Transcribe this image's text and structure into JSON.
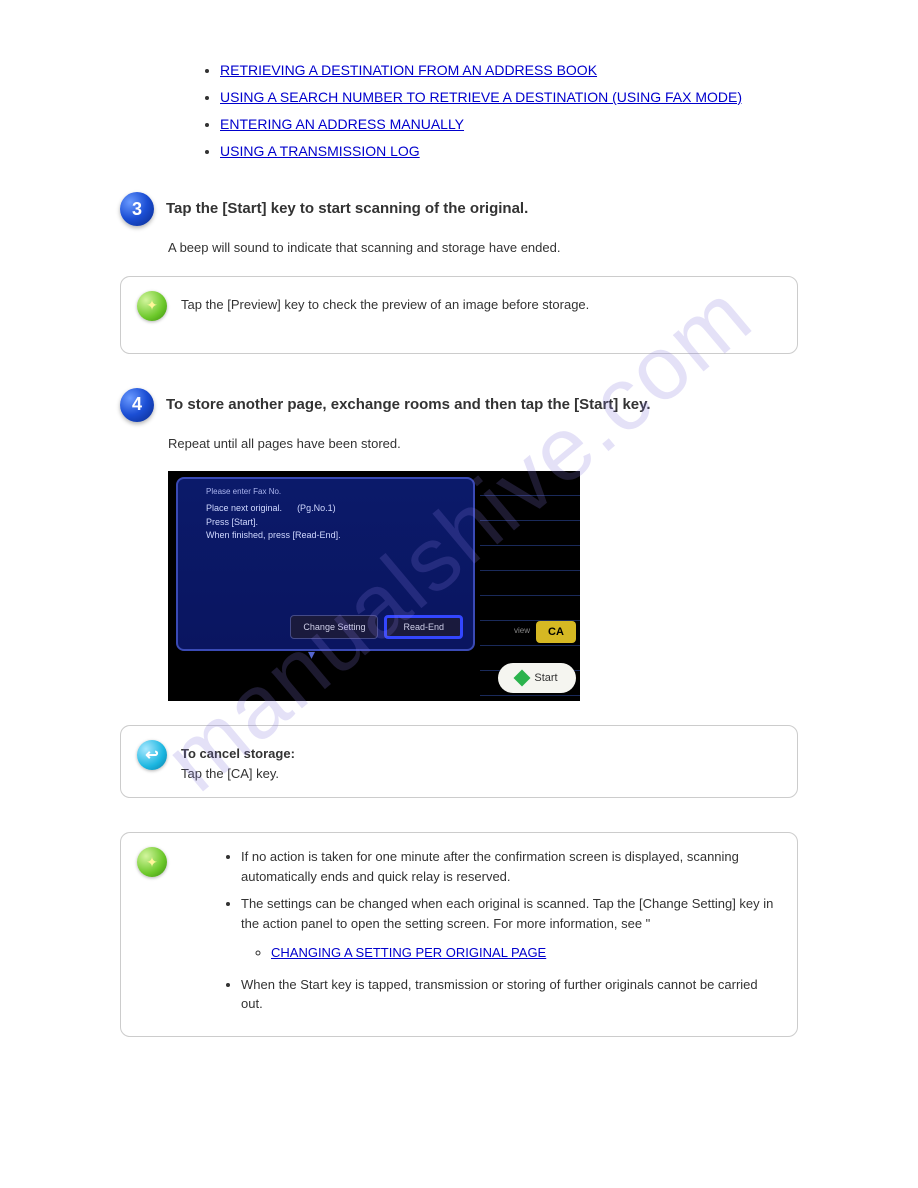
{
  "watermark": "manualshive.com",
  "top_links": [
    "RETRIEVING A DESTINATION FROM AN ADDRESS BOOK",
    "USING A SEARCH NUMBER TO RETRIEVE A DESTINATION (USING FAX MODE)",
    "ENTERING AN ADDRESS MANUALLY",
    "USING A TRANSMISSION LOG"
  ],
  "step3": {
    "label": "3",
    "text": "Tap the [Start] key to start scanning of the original.",
    "desc": "A beep will sound to indicate that scanning and storage have ended."
  },
  "note3": "Tap the [Preview] key to check the preview of an image before storage.",
  "step4": {
    "label": "4",
    "text": "To store another page, exchange rooms and then tap the [Start] key.",
    "desc": "Repeat until all pages have been stored."
  },
  "screen": {
    "header": "Please enter Fax No.",
    "line1_a": "Place next original.",
    "line1_b": "(Pg.No.1)",
    "line2": "Press [Start].",
    "line3": "When finished, press [Read-End].",
    "btn_change": "Change Setting",
    "btn_readend": "Read-End",
    "preview": "view",
    "ca": "CA",
    "start": "Start"
  },
  "cancel_note": {
    "title": "To cancel storage:",
    "text": "Tap the [CA] key."
  },
  "final_box": {
    "item1": "If no action is taken for one minute after the confirmation screen is displayed, scanning automatically ends and quick relay is reserved.",
    "item2_prefix": "The settings can be changed when each original is scanned. Tap the [Change Setting] key in the action panel to open the setting screen. For more information, see \"",
    "item2_link": "CHANGING A SETTING PER ORIGINAL PAGE",
    "item2_suffix": "\".",
    "item3": "When the Start key is tapped, transmission or storing of further originals cannot be carried out."
  }
}
